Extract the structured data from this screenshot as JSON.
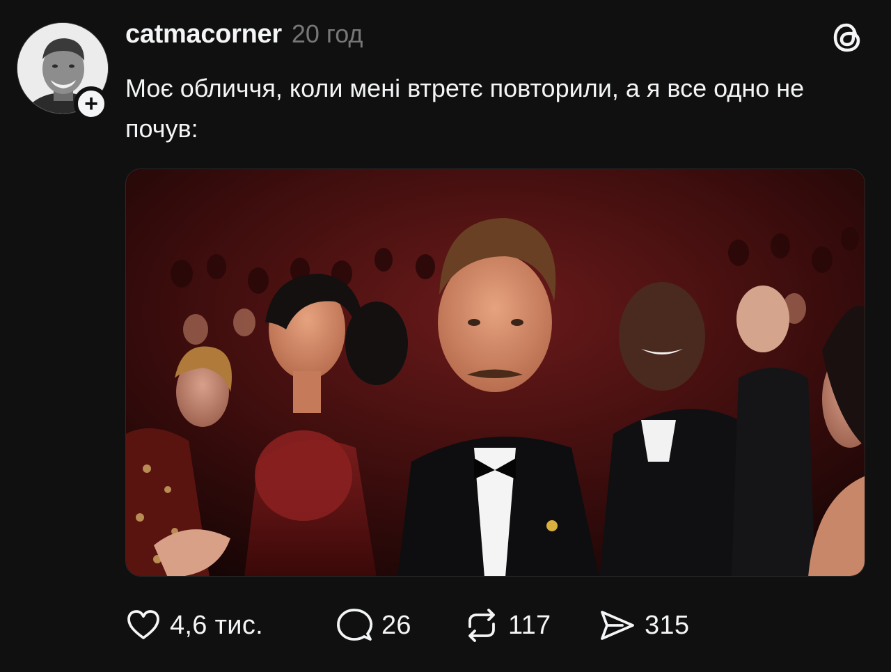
{
  "post": {
    "username": "catmacorner",
    "time": "20 год",
    "text": "Моє обличчя, коли мені втретє повторили, а я все одно не почув:",
    "follow_icon": "plus-icon",
    "app_icon": "threads-logo-icon",
    "image_description_icon": "photo"
  },
  "actions": {
    "like": {
      "icon": "heart-icon",
      "count": "4,6 тис."
    },
    "reply": {
      "icon": "comment-bubble-icon",
      "count": "26"
    },
    "repost": {
      "icon": "repost-icon",
      "count": "117"
    },
    "share": {
      "icon": "send-icon",
      "count": "315"
    }
  },
  "colors": {
    "background": "#101010",
    "text": "#f3f5f7",
    "muted": "#777777"
  }
}
